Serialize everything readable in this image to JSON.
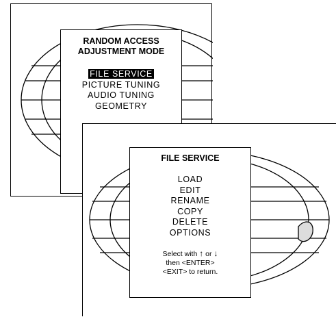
{
  "back_menu": {
    "title_line1": "RANDOM ACCESS",
    "title_line2": "ADJUSTMENT MODE",
    "items": [
      "FILE SERVICE",
      "PICTURE TUNING",
      "AUDIO TUNING",
      "GEOMETRY"
    ],
    "selected_index": 0
  },
  "front_menu": {
    "title": "FILE SERVICE",
    "items": [
      "LOAD",
      "EDIT",
      "RENAME",
      "COPY",
      "DELETE",
      "OPTIONS"
    ],
    "hint": {
      "prefix": "Select with",
      "up_arrow": "↑",
      "or_word": "or",
      "down_arrow": "↓",
      "line2": "then <ENTER>",
      "line3": "<EXIT> to return."
    }
  }
}
